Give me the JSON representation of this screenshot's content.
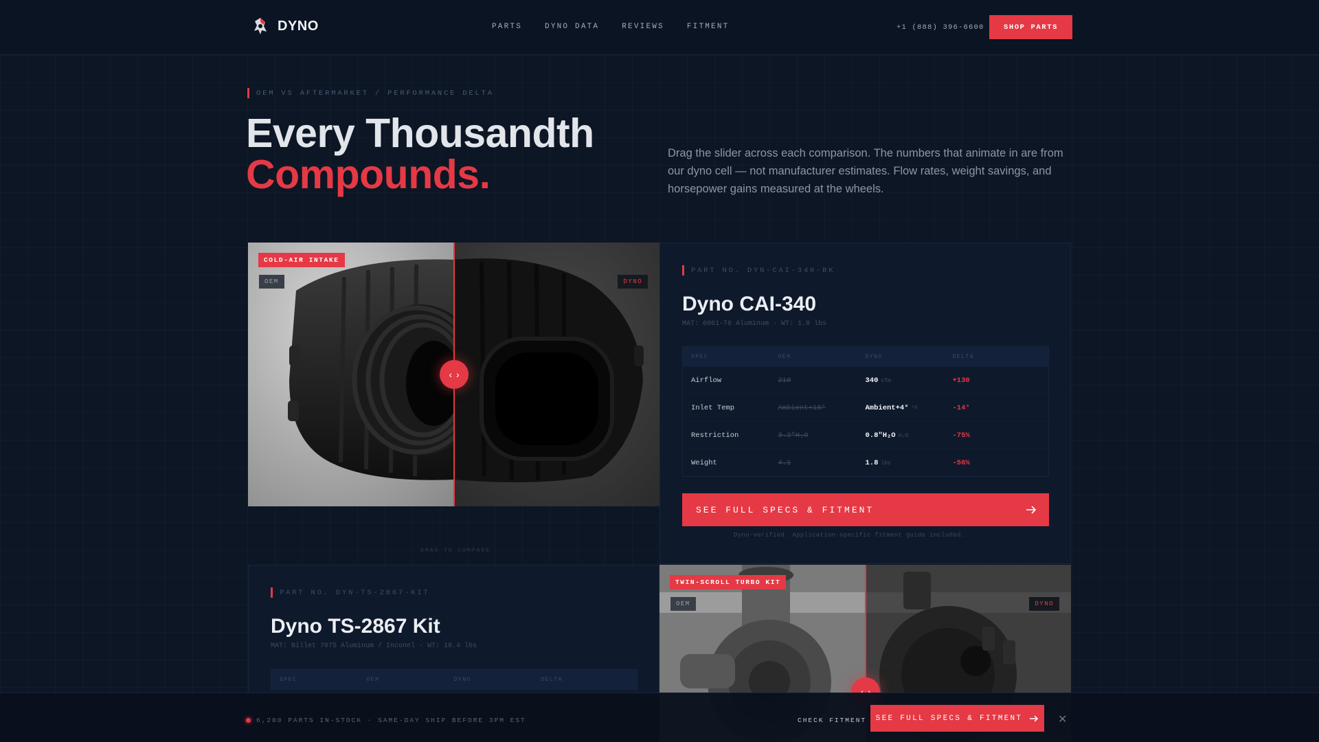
{
  "brand": {
    "name": "DYNO"
  },
  "nav": {
    "links": [
      "PARTS",
      "DYNO DATA",
      "REVIEWS",
      "FITMENT"
    ],
    "phone": "+1 (888) 396-6600",
    "cta": "SHOP PARTS"
  },
  "hero": {
    "eyebrow": "OEM VS AFTERMARKET / PERFORMANCE DELTA",
    "title_line1": "Every Thousandth",
    "title_line2": "Compounds.",
    "description": "Drag the slider across each comparison. The numbers that animate in are from our dyno cell — not manufacturer estimates. Flow rates, weight savings, and horsepower gains measured at the wheels."
  },
  "products": [
    {
      "category": "COLD-AIR INTAKE",
      "oem_tag": "OEM",
      "dyno_tag": "DYNO",
      "part_no": "PART NO. DYN-CAI-340-BK",
      "name": "Dyno CAI-340",
      "meta": "MAT: 6061-T6 Aluminum · WT: 1.8 lbs",
      "slider_position": 0.5,
      "table": {
        "headers": [
          "SPEC",
          "OEM",
          "DYNO",
          "DELTA"
        ],
        "rows": [
          {
            "spec": "Airflow",
            "oem": "210",
            "dyno": "340",
            "unit": "cfm",
            "delta": "+130"
          },
          {
            "spec": "Inlet Temp",
            "oem": "Ambient+18°",
            "dyno": "Ambient+4°",
            "unit": "°F",
            "delta": "-14°"
          },
          {
            "spec": "Restriction",
            "oem": "3.2\"H₂O",
            "dyno": "0.8\"H₂O",
            "unit": "H₂O",
            "delta": "-75%"
          },
          {
            "spec": "Weight",
            "oem": "4.1",
            "dyno": "1.8",
            "unit": "lbs",
            "delta": "-56%"
          }
        ]
      },
      "cta": "SEE FULL SPECS & FITMENT",
      "footnote": "Dyno-verified. Application-specific fitment guide included.",
      "drag_hint": "DRAG TO COMPARE"
    },
    {
      "category": "TWIN-SCROLL TURBO KIT",
      "oem_tag": "OEM",
      "dyno_tag": "DYNO",
      "part_no": "PART NO. DYN-TS-2867-KIT",
      "name": "Dyno TS-2867 Kit",
      "meta": "MAT: Billet 7075 Aluminum / Inconel · WT: 18.4 lbs",
      "slider_position": 0.5,
      "table": {
        "headers": [
          "SPEC",
          "OEM",
          "DYNO",
          "DELTA"
        ]
      }
    }
  ],
  "sticky": {
    "stock": "6,200 PARTS IN-STOCK · SAME-DAY SHIP BEFORE 3PM EST",
    "check_fitment": "CHECK FITMENT",
    "cta": "SEE FULL SPECS & FITMENT",
    "close_icon": "close-icon"
  },
  "colors": {
    "accent": "#e53945",
    "background": "#0c1625",
    "panel": "#0e1a2c"
  }
}
